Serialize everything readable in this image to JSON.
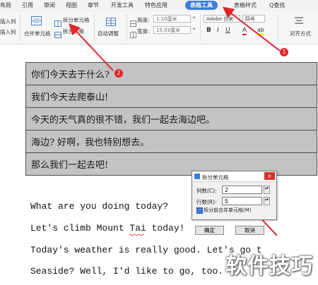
{
  "tabs": [
    "布局",
    "引用",
    "审阅",
    "视图",
    "章节",
    "开发工具",
    "特色应用",
    "表格工具",
    "表格样式",
    "Q查找"
  ],
  "ribbon": {
    "insert_col_left": "插入列",
    "insert_col_right": "插入列",
    "merge_cells": "合并单元格",
    "split_cells": "拆分单元格",
    "split_table": "拆分表格",
    "auto_fit": "自动调整",
    "height_label": "高度:",
    "height_value": "1.10厘米",
    "width_label": "宽度:",
    "width_value": "15.03厘米",
    "font_name": "Adobe 仿宋",
    "font_size": "四号",
    "bold": "B",
    "italic": "I",
    "underline": "U",
    "font_color": "A",
    "highlight": "ab",
    "align": "对齐方式"
  },
  "table_rows": [
    "你们今天去于什么?",
    "我们今天去爬泰山!",
    "今天的天气真的很不错，我们一起去海边吧。",
    "海边? 好啊，我也特别想去。",
    "那么我们一起去吧!"
  ],
  "english_lines": [
    "What are you doing today?",
    "Let's climb Mount Tai today!",
    "Today's weather is really good. Let's go t",
    "Seaside? Well, I'd like to go, too."
  ],
  "dialog": {
    "title": "拆分单元格",
    "columns_label": "列数(C):",
    "columns_value": "2",
    "rows_label": "行数(R):",
    "rows_value": "5",
    "merge_before_split": "拆分前合并单元格(M)",
    "ok": "确定",
    "cancel": "取消"
  },
  "badges": {
    "b1": "1",
    "b2": "2"
  },
  "watermark": "软件技巧",
  "colors": {
    "accent": "#3d7cdc",
    "arrow": "#e0262b",
    "table_fill": "#c3c3c3"
  }
}
